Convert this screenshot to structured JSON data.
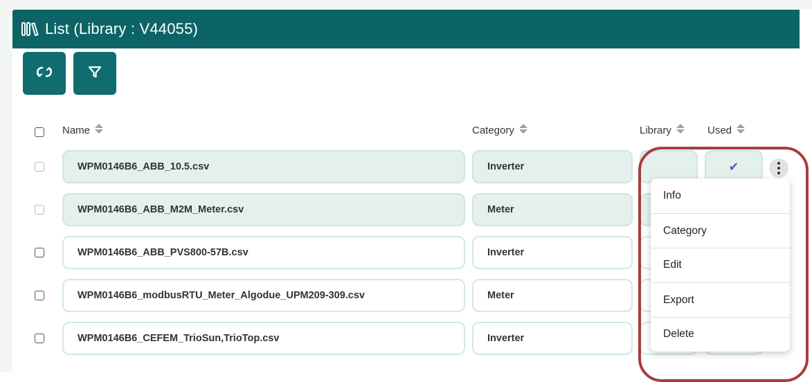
{
  "header": {
    "title": "List (Library : V44055)",
    "icon": "library-books-icon"
  },
  "toolbar": {
    "refresh_icon": "refresh-link-icon",
    "filter_icon": "filter-icon"
  },
  "table": {
    "columns": {
      "name": "Name",
      "category": "Category",
      "library": "Library",
      "used": "Used"
    },
    "rows": [
      {
        "name": "WPM0146B6_ABB_10.5.csv",
        "category": "Inverter",
        "used": "✔"
      },
      {
        "name": "WPM0146B6_ABB_M2M_Meter.csv",
        "category": "Meter",
        "used": ""
      },
      {
        "name": "WPM0146B6_ABB_PVS800-57B.csv",
        "category": "Inverter",
        "used": ""
      },
      {
        "name": "WPM0146B6_modbusRTU_Meter_Algodue_UPM209-309.csv",
        "category": "Meter",
        "used": ""
      },
      {
        "name": "WPM0146B6_CEFEM_TrioSun,TrioTop.csv",
        "category": "Inverter",
        "used": ""
      }
    ]
  },
  "context_menu": {
    "items": [
      "Info",
      "Category",
      "Edit",
      "Export",
      "Delete"
    ]
  },
  "colors": {
    "header_bg": "#0d6466",
    "accent": "#0f6d70",
    "annotation": "#a83c3c",
    "check": "#6a55d0"
  }
}
